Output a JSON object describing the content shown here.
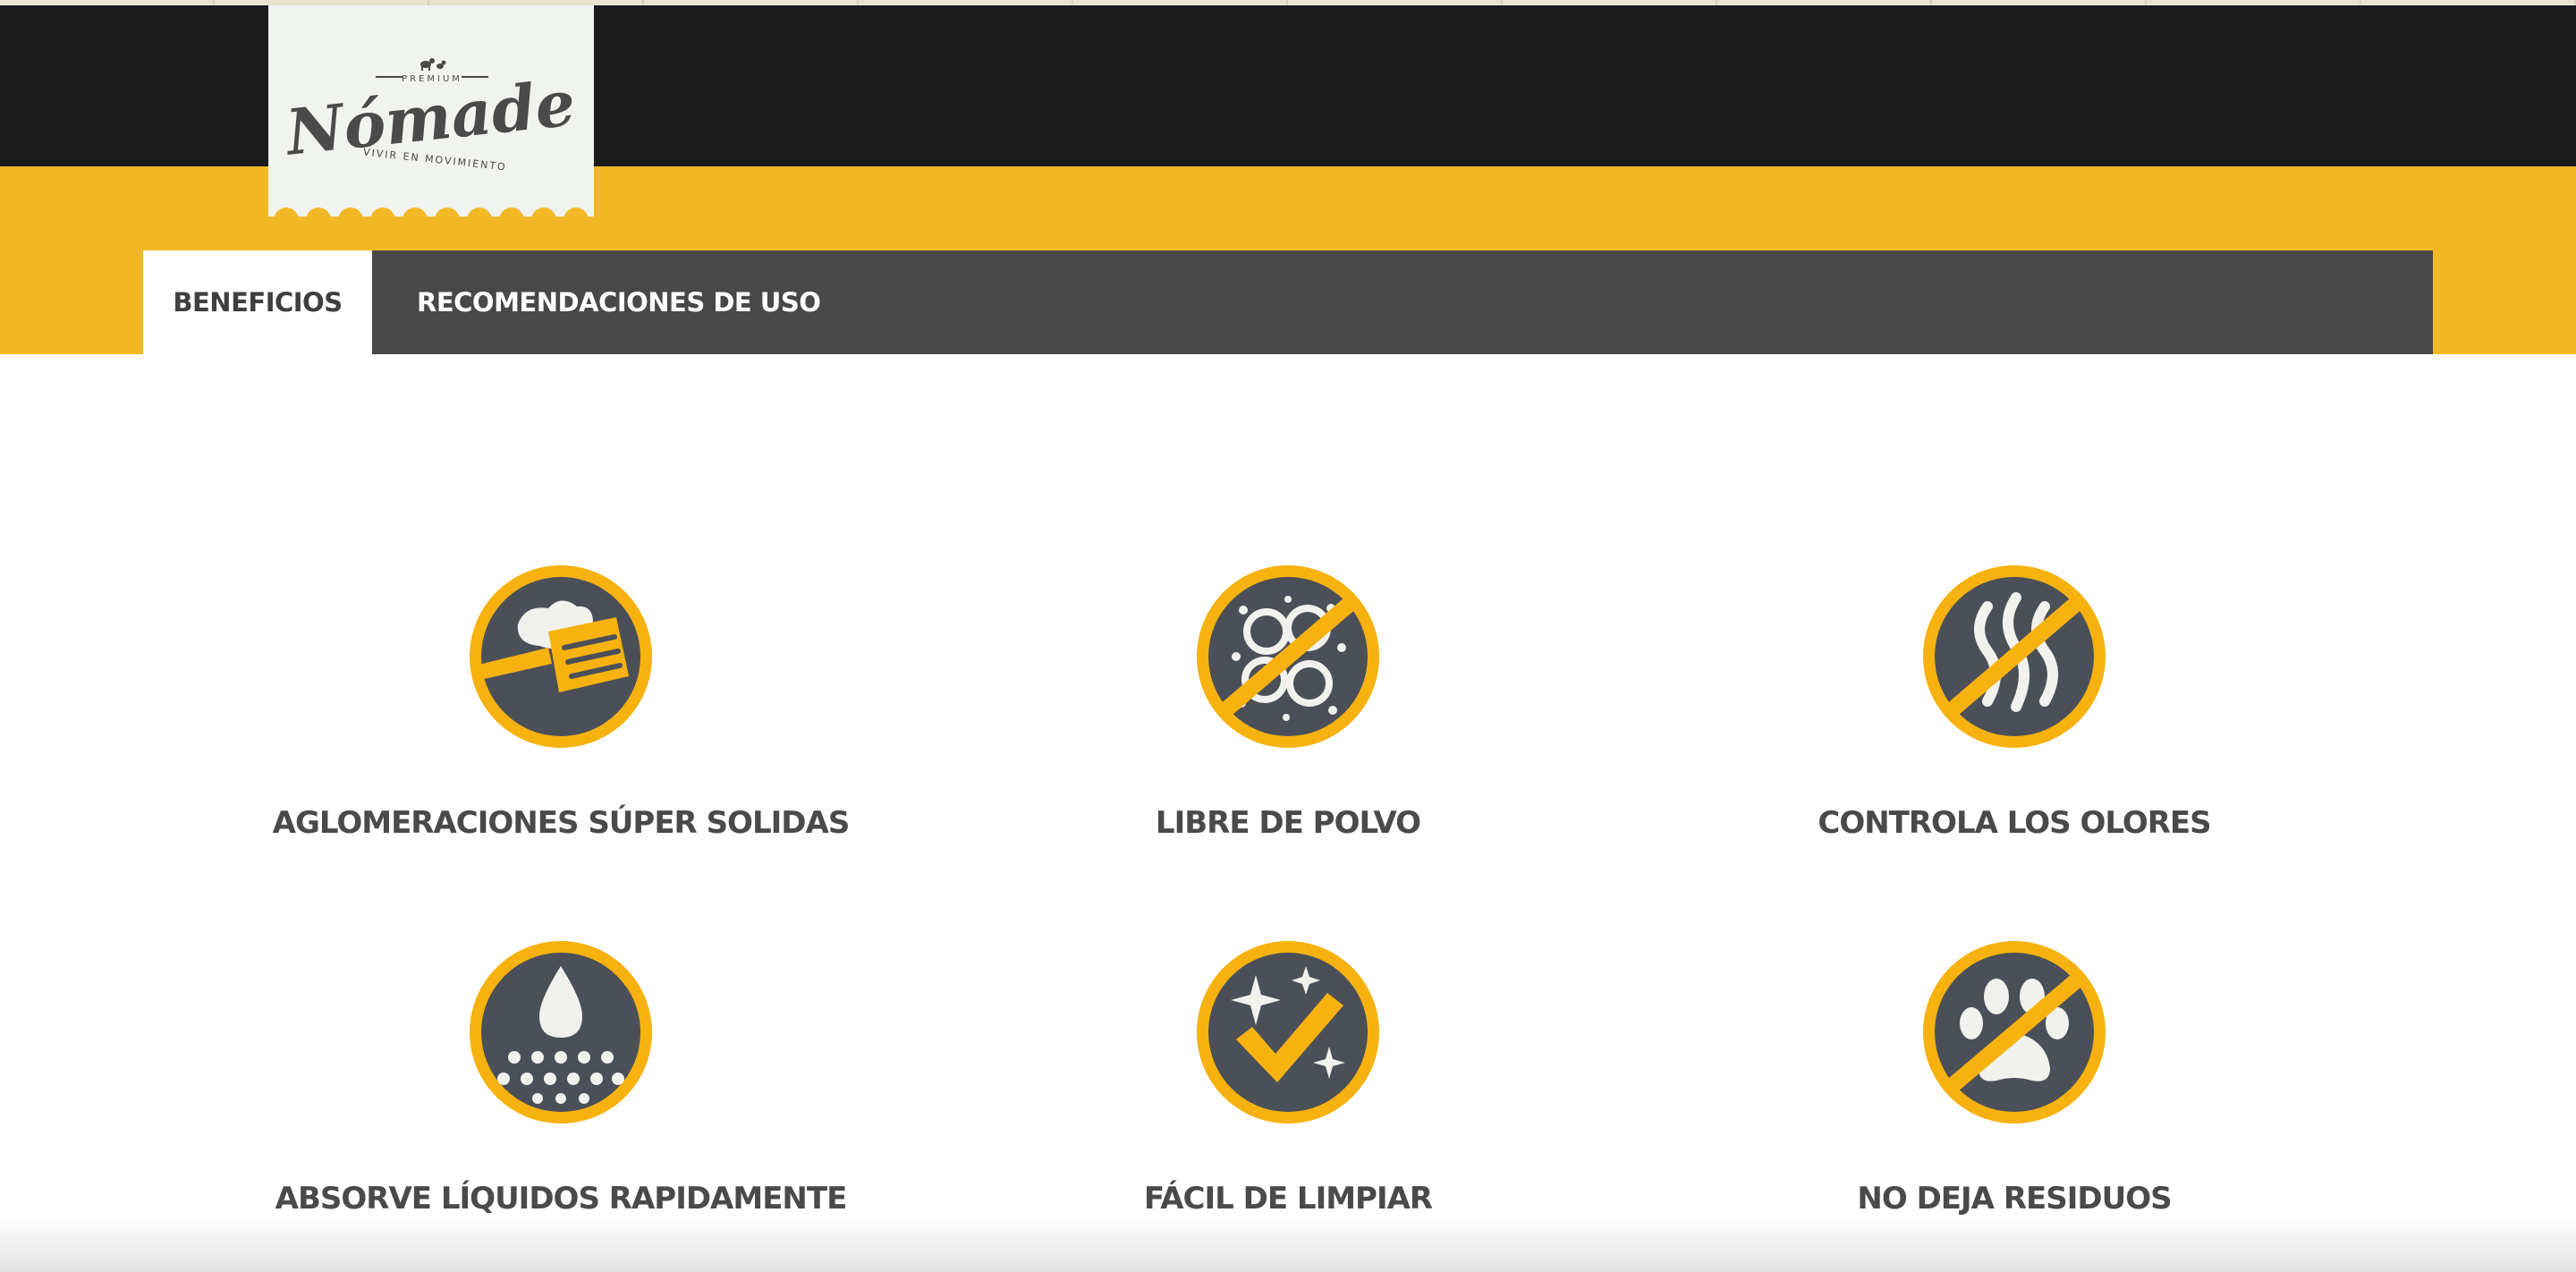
{
  "brand": {
    "premium": "PREMIUM",
    "name": "Nómade",
    "tagline": "VIVIR EN MOVIMIENTO"
  },
  "tabs": [
    {
      "label": "BENEFICIOS",
      "active": true
    },
    {
      "label": "RECOMENDACIONES DE USO",
      "active": false
    }
  ],
  "benefits": [
    {
      "label": "AGLOMERACIONES SÚPER SOLIDAS",
      "icon": "scoop-clump-icon"
    },
    {
      "label": "LIBRE DE POLVO",
      "icon": "no-dust-icon"
    },
    {
      "label": "CONTROLA LOS OLORES",
      "icon": "no-odor-icon"
    },
    {
      "label": "ABSORVE LÍQUIDOS RAPIDAMENTE",
      "icon": "liquid-drop-icon"
    },
    {
      "label": "FÁCIL DE LIMPIAR",
      "icon": "sparkle-check-icon"
    },
    {
      "label": "NO DEJA RESIDUOS",
      "icon": "no-paw-residue-icon"
    }
  ],
  "colors": {
    "dark": "#1b1b1b",
    "yellow": "#f3b826",
    "tabbar": "#484848",
    "icon_ring": "#f7b20f",
    "icon_fill": "#4b5058",
    "icon_glyph": "#f1f1ee",
    "label": "#4a4a4a"
  }
}
